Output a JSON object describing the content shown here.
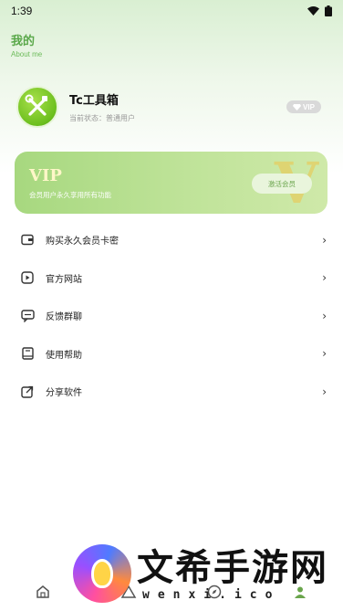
{
  "status_bar": {
    "time": "1:39",
    "wifi_icon": "wifi-icon",
    "battery_icon": "battery-icon"
  },
  "header": {
    "title": "我的",
    "subtitle": "About me"
  },
  "profile": {
    "avatar_icon": "tools-icon",
    "name": "Tc工具箱",
    "status": "当前状态：普通用户",
    "badge": "VIP"
  },
  "vip_card": {
    "title": "VIP",
    "description": "会员用户永久享用所有功能",
    "button_label": "激活会员",
    "decoration": "V"
  },
  "menu": {
    "items": [
      {
        "label": "购买永久会员卡密",
        "icon": "wallet-icon"
      },
      {
        "label": "官方网站",
        "icon": "play-icon"
      },
      {
        "label": "反馈群聊",
        "icon": "chat-icon"
      },
      {
        "label": "使用帮助",
        "icon": "book-icon"
      },
      {
        "label": "分享软件",
        "icon": "share-icon"
      }
    ],
    "chevron": "›"
  },
  "bottom_nav": {
    "items": [
      "home-icon",
      "triangle-icon",
      "compass-icon",
      "profile-icon"
    ]
  },
  "watermark": {
    "title": "文希手游网",
    "url": "wenxi.ico"
  },
  "colors": {
    "accent": "#6aa54c",
    "card": "#b4dd8c"
  }
}
